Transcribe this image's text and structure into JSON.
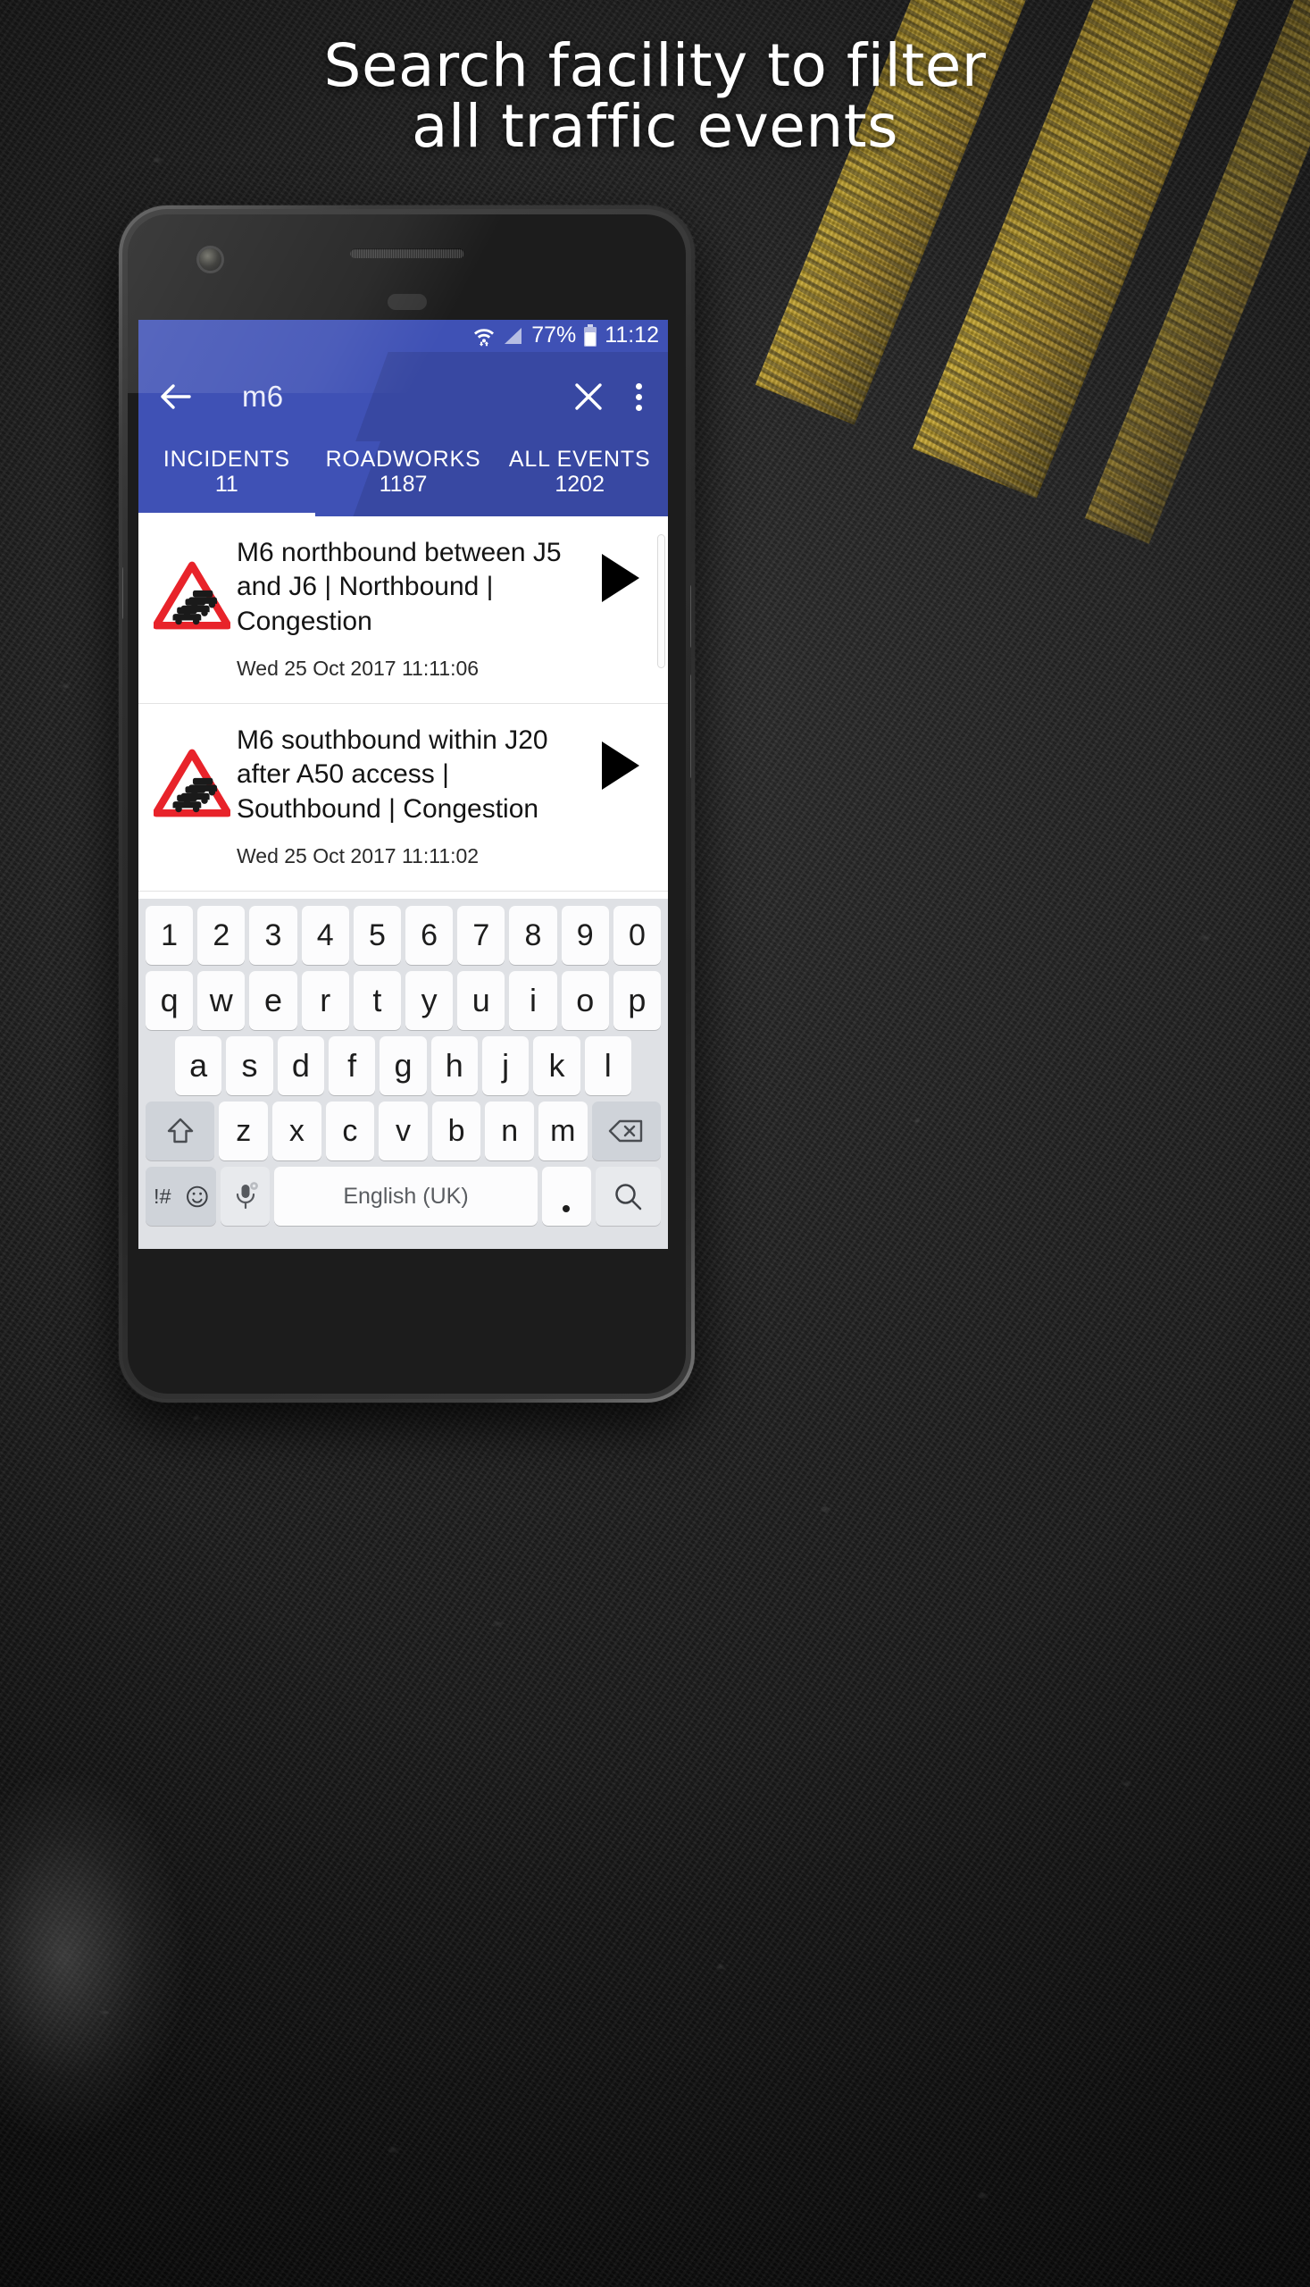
{
  "promo": {
    "headline_line1": "Search facility to filter",
    "headline_line2": "all traffic events"
  },
  "status_bar": {
    "battery_percent": "77%",
    "time": "11:12",
    "wifi_icon": "wifi-icon",
    "signal_icon": "signal-icon",
    "battery_icon": "battery-icon"
  },
  "app_bar": {
    "back_icon": "back-arrow-icon",
    "search_query": "m6",
    "clear_icon": "close-icon",
    "overflow_icon": "overflow-menu-icon"
  },
  "tabs": [
    {
      "label": "INCIDENTS",
      "count": "11",
      "active": true
    },
    {
      "label": "ROADWORKS",
      "count": "1187",
      "active": false
    },
    {
      "label": "ALL EVENTS",
      "count": "1202",
      "active": false
    }
  ],
  "events": [
    {
      "icon": "queuing-traffic-warning-icon",
      "title": "M6 northbound between J5 and J6 | Northbound | Congestion",
      "timestamp": "Wed 25 Oct 2017 11:11:06",
      "action_icon": "play-icon"
    },
    {
      "icon": "queuing-traffic-warning-icon",
      "title": "M6 southbound within J20 after A50 access | Southbound | Congestion",
      "timestamp": "Wed 25 Oct 2017 11:11:02",
      "action_icon": "play-icon"
    }
  ],
  "keyboard": {
    "row1": [
      "1",
      "2",
      "3",
      "4",
      "5",
      "6",
      "7",
      "8",
      "9",
      "0"
    ],
    "row2": [
      "q",
      "w",
      "e",
      "r",
      "t",
      "y",
      "u",
      "i",
      "o",
      "p"
    ],
    "row3": [
      "a",
      "s",
      "d",
      "f",
      "g",
      "h",
      "j",
      "k",
      "l"
    ],
    "row4": [
      "z",
      "x",
      "c",
      "v",
      "b",
      "n",
      "m"
    ],
    "shift_icon": "shift-icon",
    "backspace_icon": "backspace-icon",
    "symbols_label": "!#",
    "symbols_icon": "emoji-icon",
    "mic_icon": "microphone-icon",
    "mic_settings_icon": "gear-icon",
    "space_label": "English (UK)",
    "period_label": ".",
    "search_icon": "search-icon"
  },
  "colors": {
    "primary": "#3f51b5",
    "status_bar": "#3f51b5",
    "warning_sign_red": "#e8232a",
    "keyboard_bg": "#dfe1e5",
    "key_bg": "#fcfcfd",
    "key_fn_bg": "#cfd3d9"
  }
}
